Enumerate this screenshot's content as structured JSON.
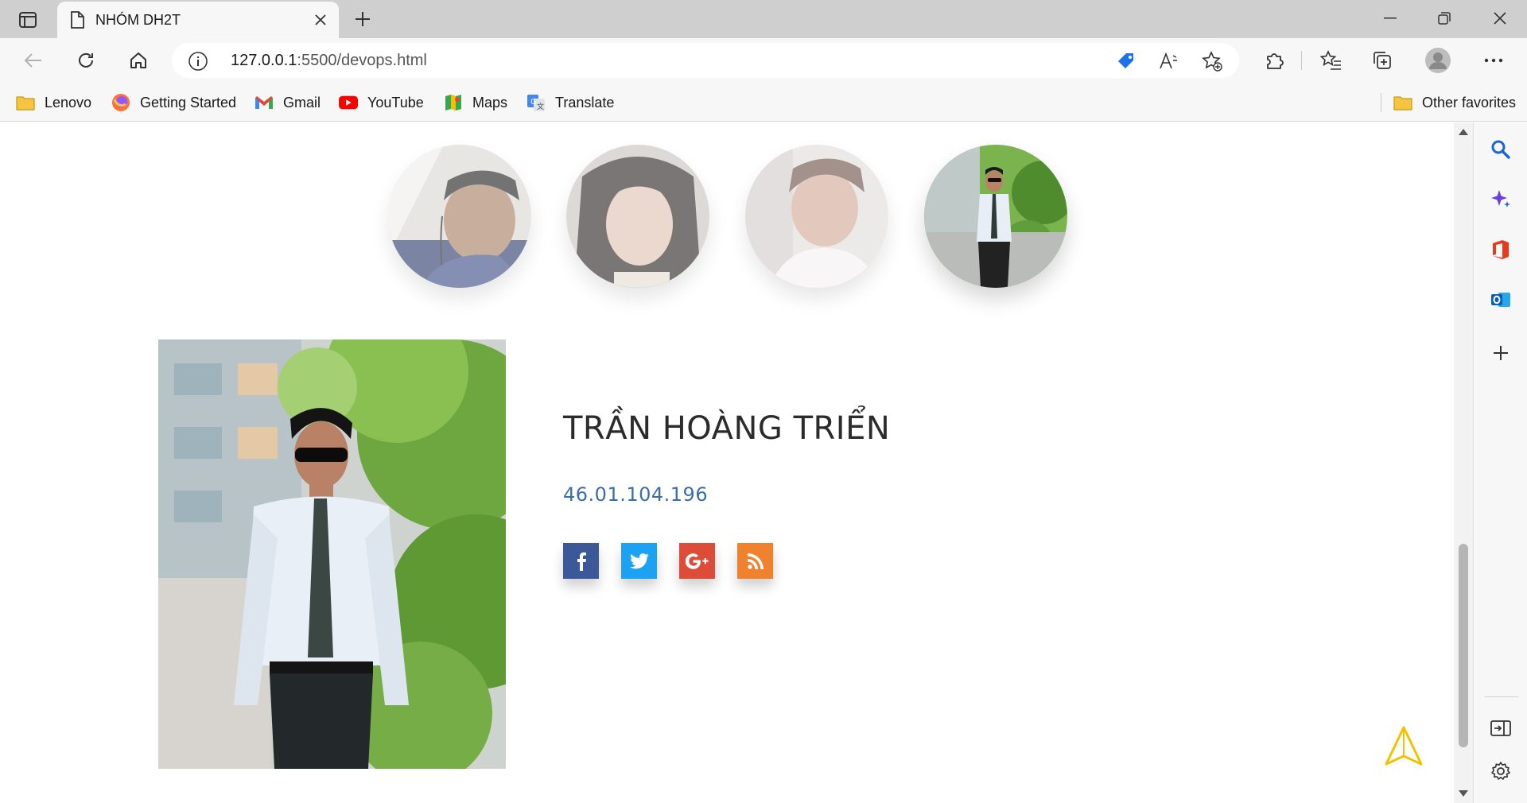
{
  "browser": {
    "tab_title": "NHÓM DH2T",
    "url_host": "127.0.0.1",
    "url_path": ":5500/devops.html",
    "favorites": [
      {
        "label": "Lenovo",
        "icon": "folder-icon"
      },
      {
        "label": "Getting Started",
        "icon": "firefox-icon"
      },
      {
        "label": "Gmail",
        "icon": "gmail-icon"
      },
      {
        "label": "YouTube",
        "icon": "youtube-icon"
      },
      {
        "label": "Maps",
        "icon": "maps-icon"
      },
      {
        "label": "Translate",
        "icon": "translate-icon"
      }
    ],
    "other_favorites": "Other favorites"
  },
  "page": {
    "avatars": [
      {
        "name": "member-avatar-1",
        "state": "faded"
      },
      {
        "name": "member-avatar-2",
        "state": "faded"
      },
      {
        "name": "member-avatar-3",
        "state": "faded"
      },
      {
        "name": "member-avatar-4",
        "state": "active"
      }
    ],
    "member": {
      "name": "TRẦN HOÀNG TRIỂN",
      "id": "46.01.104.196"
    },
    "socials": [
      {
        "network": "facebook",
        "glyph": "f",
        "color": "#3b5998"
      },
      {
        "network": "twitter",
        "glyph": "t",
        "color": "#1da1f2"
      },
      {
        "network": "google-plus",
        "glyph": "G+",
        "color": "#dd4b39"
      },
      {
        "network": "rss",
        "glyph": "rss",
        "color": "#f0812f"
      }
    ]
  },
  "colors": {
    "accent_blue": "#3b6ea8",
    "back_to_top": "#f2c200"
  }
}
